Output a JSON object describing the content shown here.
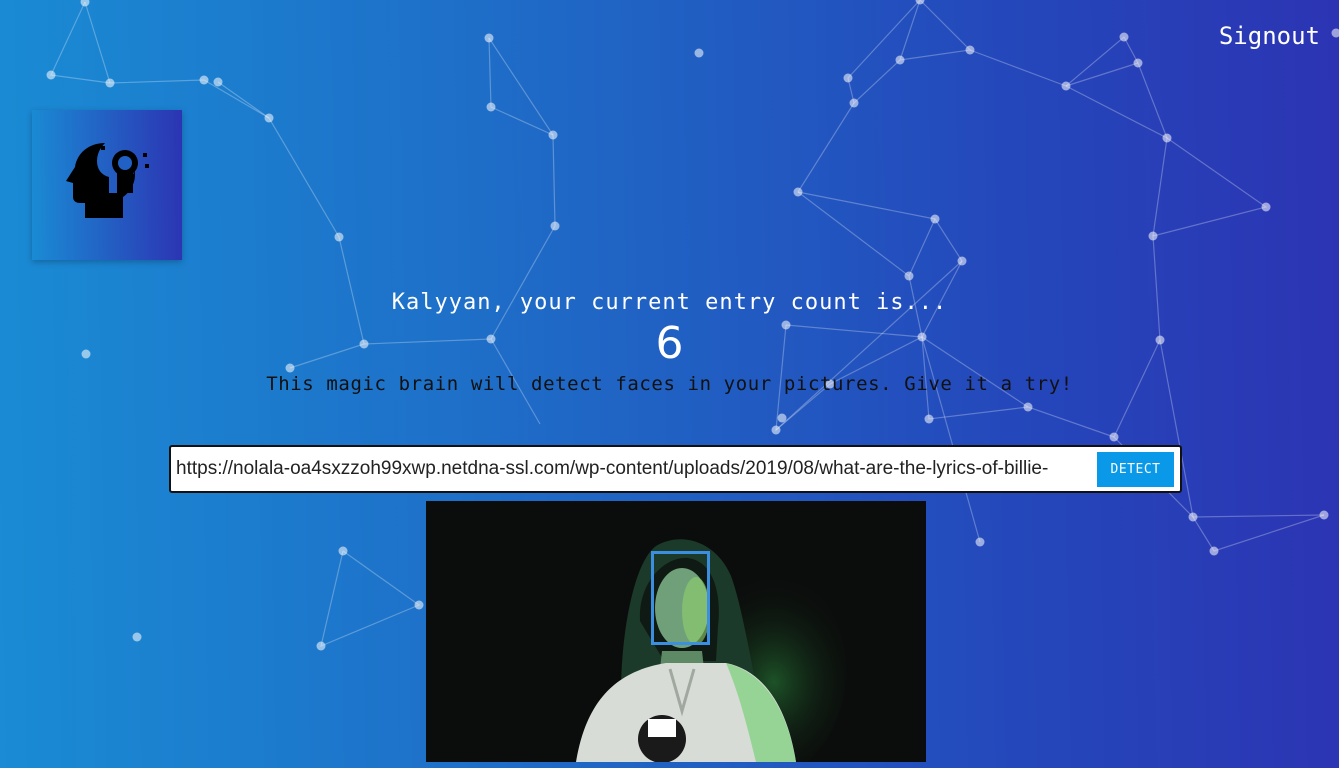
{
  "header": {
    "signout_label": "Signout"
  },
  "logo": {
    "icon": "brain-head-icon"
  },
  "rank": {
    "message": "Kalyyan, your current entry count is...",
    "count": "6"
  },
  "intro": {
    "text": "This magic brain will detect faces in your pictures. Give it a try!"
  },
  "form": {
    "url_value": "https://nolala-oa4sxzzoh99xwp.netdna-ssl.com/wp-content/uploads/2019/08/what-are-the-lyrics-of-billie-",
    "detect_label": "DETECT"
  },
  "colors": {
    "accent": "#0a99e8",
    "face_box": "#3c8fe0",
    "background_start": "#1a8bd4",
    "background_end": "#2c34b3"
  }
}
